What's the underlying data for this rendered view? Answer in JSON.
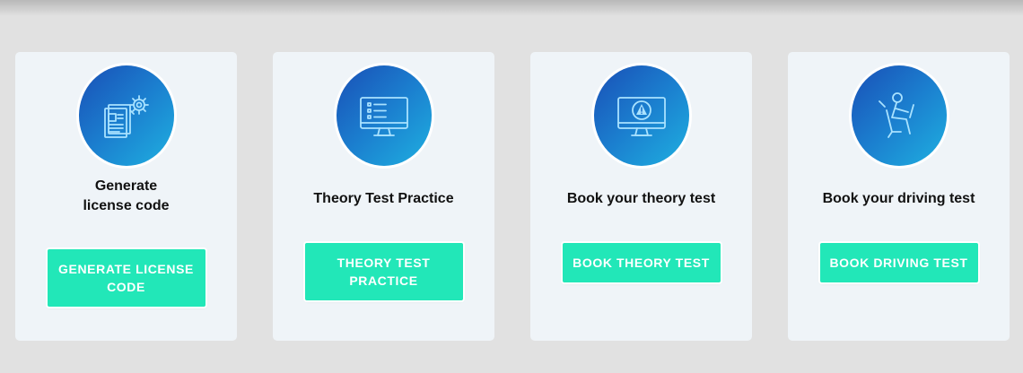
{
  "cards": [
    {
      "title_line1": "Generate",
      "title_line2": "license code",
      "button": "GENERATE LICENSE CODE",
      "icon": "license-code-gear-icon"
    },
    {
      "title": "Theory Test Practice",
      "button": "THEORY TEST PRACTICE",
      "icon": "monitor-checklist-icon"
    },
    {
      "title": "Book your theory test",
      "button": "BOOK THEORY TEST",
      "icon": "monitor-warning-icon"
    },
    {
      "title": "Book your driving test",
      "button": "BOOK DRIVING TEST",
      "icon": "driver-steering-wheel-icon"
    }
  ],
  "colors": {
    "page_background": "#e1e1e1",
    "card_background": "#eff4f8",
    "icon_gradient_start": "#1a4fb6",
    "icon_gradient_end": "#1fb0e0",
    "button_background": "#22e7b8",
    "button_text": "#ffffff"
  }
}
